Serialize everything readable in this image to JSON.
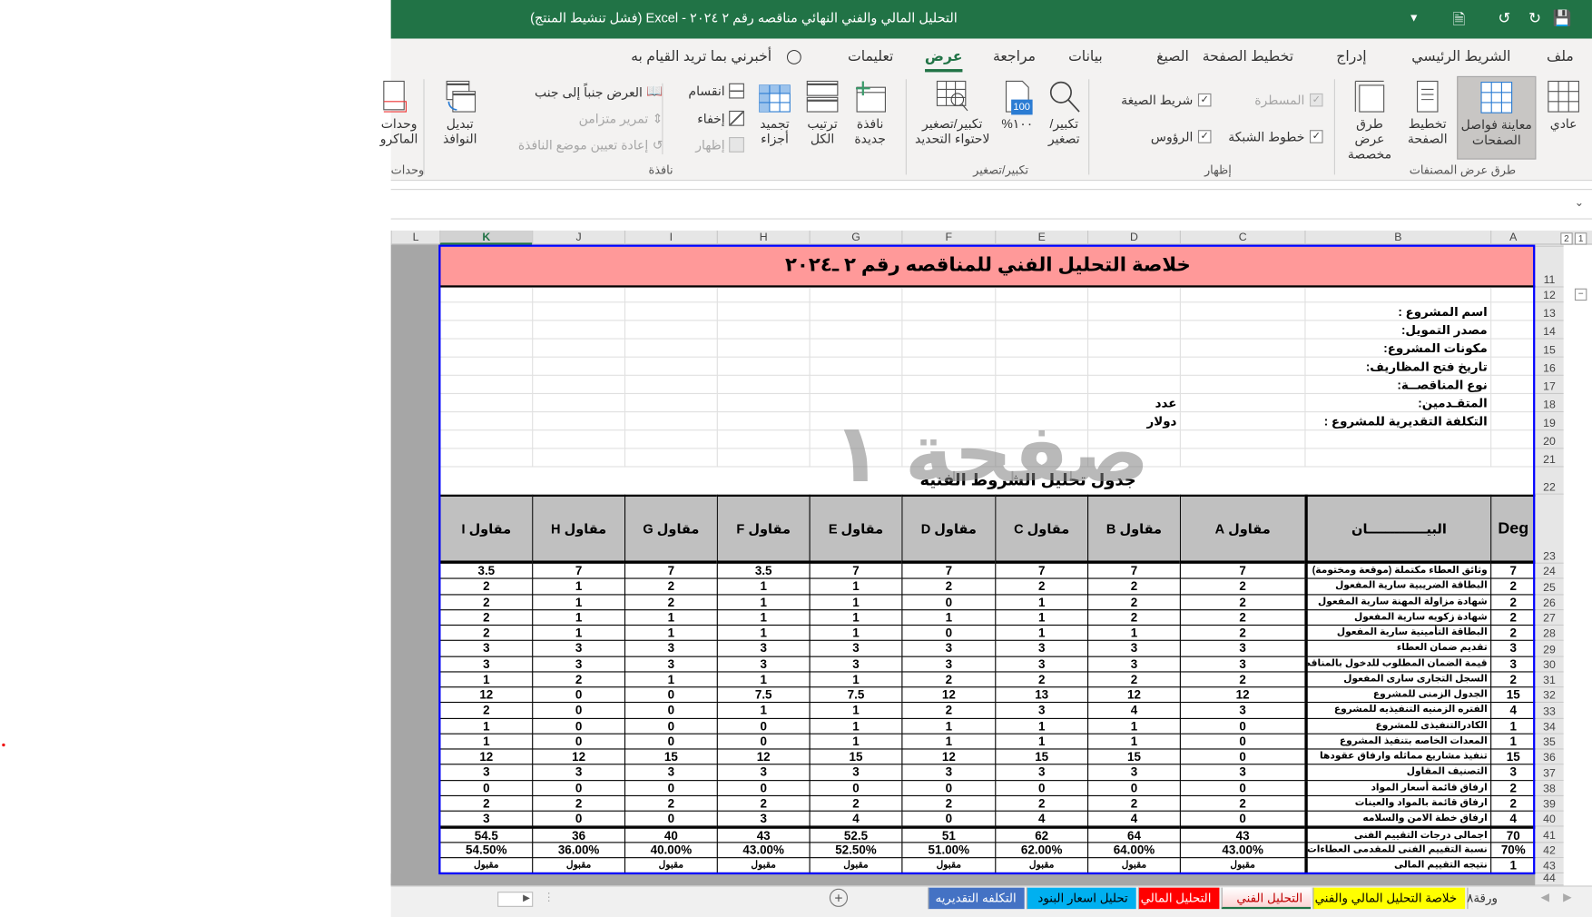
{
  "window": {
    "title": "التحليل المالي والفني النهائي مناقصه رقم ٢ ٢٠٢٤  -  Excel (فشل تنشيط المنتج)"
  },
  "menu": {
    "tabs": [
      "ملف",
      "الشريط الرئيسي",
      "إدراج",
      "تخطيط الصفحة",
      "الصيغ",
      "بيانات",
      "مراجعة",
      "عرض",
      "تعليمات"
    ],
    "active": "عرض",
    "tell_me": "أخبرني بما تريد القيام به"
  },
  "ribbon": {
    "views": {
      "group": "طرق عرض المصنفات",
      "normal": "عادي",
      "page_break": "معاينة فواصل الصفحات",
      "page_layout": "تخطيط الصفحة",
      "custom": "طرق عرض مخصصة"
    },
    "show": {
      "group": "إظهار",
      "ruler": "المسطرة",
      "formula_bar": "شريط الصيغة",
      "gridlines": "خطوط الشبكة",
      "headings": "الرؤوس"
    },
    "zoom": {
      "group": "تكبير/تصغير",
      "zoom": "تكبير/ تصغير",
      "zoom100": "١٠٠%",
      "icon100": "100",
      "zoom_sel": "تكبير/تصغير لاحتواء التحديد"
    },
    "window": {
      "group": "نافذة",
      "new": "نافذة جديدة",
      "arrange": "ترتيب الكل",
      "freeze": "تجميد أجزاء",
      "split": "انقسام",
      "hide": "إخفاء",
      "unhide": "إظهار",
      "side": "العرض جنباً إلى جنب",
      "sync": "تمرير متزامن",
      "reset": "إعادة تعيين موضع النافذة",
      "switch": "تبديل النوافذ"
    },
    "macros": {
      "group": "وحدات",
      "label": "وحدات الماكرو"
    }
  },
  "sheet": {
    "columns": [
      "A",
      "B",
      "C",
      "D",
      "E",
      "F",
      "G",
      "H",
      "I",
      "J",
      "K",
      "L"
    ],
    "selected_column": "K",
    "title": "خلاصة التحليل الفني للمناقصه رقم ٢ ـ٢٠٢٤",
    "info": [
      {
        "row": "13",
        "label": "اسم المشروع :",
        "value": ""
      },
      {
        "row": "14",
        "label": "مصدر التمويل:",
        "value": ""
      },
      {
        "row": "15",
        "label": "مكونات المشروع:",
        "value": ""
      },
      {
        "row": "16",
        "label": "تاريخ فتح المظاريف:",
        "value": ""
      },
      {
        "row": "17",
        "label": "نوع المناقصــة:",
        "value": ""
      },
      {
        "row": "18",
        "label": "المتقـدمين:",
        "value": "عدد"
      },
      {
        "row": "19",
        "label": "التكلفة التقديرية للمشروع :",
        "value": "دولار"
      }
    ],
    "table_title": "جدول تحليل الشروط الفنيه",
    "watermark": "صفحة ١",
    "headers": {
      "deg": "Deg",
      "item": "البيـــــــــــــان",
      "contractors": [
        "مقاول A",
        "مقاول B",
        "مقاول C",
        "مقاول D",
        "مقاول E",
        "مقاول F",
        "مقاول G",
        "مقاول H",
        "مقاول I"
      ]
    },
    "rows": [
      {
        "row": "24",
        "deg": "7",
        "item": "وثائق العطاء مكتملة (موقعة ومختومة)",
        "v": [
          "7",
          "7",
          "7",
          "7",
          "7",
          "3.5",
          "7",
          "7",
          "3.5"
        ]
      },
      {
        "row": "25",
        "deg": "2",
        "item": "البطاقة الضريبية سارية المفعول",
        "v": [
          "2",
          "2",
          "2",
          "2",
          "1",
          "1",
          "2",
          "1",
          "2"
        ]
      },
      {
        "row": "26",
        "deg": "2",
        "item": "شهادة مزاولة المهنة سارية المفعول",
        "v": [
          "2",
          "2",
          "1",
          "0",
          "1",
          "1",
          "2",
          "1",
          "2"
        ]
      },
      {
        "row": "27",
        "deg": "2",
        "item": "شهادة زكويه سارية المفعول",
        "v": [
          "2",
          "2",
          "1",
          "1",
          "1",
          "1",
          "1",
          "1",
          "2"
        ]
      },
      {
        "row": "28",
        "deg": "2",
        "item": "البطاقة التأمينية  سارية المفعول",
        "v": [
          "2",
          "1",
          "1",
          "0",
          "1",
          "1",
          "1",
          "1",
          "2"
        ]
      },
      {
        "row": "29",
        "deg": "3",
        "item": " تقديم ضمان العطاء",
        "v": [
          "3",
          "3",
          "3",
          "3",
          "3",
          "3",
          "3",
          "3",
          "3"
        ]
      },
      {
        "row": "30",
        "deg": "3",
        "item": "قيمة الضمان المطلوب للدخول بالمناقصه",
        "v": [
          "3",
          "3",
          "3",
          "3",
          "3",
          "3",
          "3",
          "3",
          "3"
        ]
      },
      {
        "row": "31",
        "deg": "2",
        "item": "السجل التجارى سارى المفعول",
        "v": [
          "2",
          "2",
          "2",
          "2",
          "1",
          "1",
          "1",
          "2",
          "1"
        ]
      },
      {
        "row": "32",
        "deg": "15",
        "item": "الجدول الزمنى للمشروع",
        "v": [
          "12",
          "12",
          "13",
          "12",
          "7.5",
          "7.5",
          "0",
          "0",
          "12"
        ]
      },
      {
        "row": "33",
        "deg": "4",
        "item": "الفتره الزمنيه التنفيذيه للمشروع",
        "v": [
          "3",
          "4",
          "3",
          "2",
          "1",
          "1",
          "0",
          "0",
          "2"
        ]
      },
      {
        "row": "34",
        "deg": "1",
        "item": "الكادرالتنفيذى للمشروع",
        "v": [
          "0",
          "1",
          "1",
          "1",
          "1",
          "0",
          "0",
          "0",
          "1"
        ]
      },
      {
        "row": "35",
        "deg": "1",
        "item": "المعدات الخاصه بتنفيذ المشروع",
        "v": [
          "0",
          "1",
          "1",
          "1",
          "1",
          "0",
          "0",
          "0",
          "1"
        ]
      },
      {
        "row": "36",
        "deg": "15",
        "item": "تنفيذ مشاريع مماثله وارفاق عقودها",
        "v": [
          "0",
          "15",
          "15",
          "12",
          "15",
          "12",
          "15",
          "12",
          "12"
        ]
      },
      {
        "row": "37",
        "deg": "3",
        "item": "التصنيف المقاول",
        "v": [
          "3",
          "3",
          "3",
          "3",
          "3",
          "3",
          "3",
          "3",
          "3"
        ]
      },
      {
        "row": "38",
        "deg": "2",
        "item": "ارفاق قائمة أسعار المواد",
        "v": [
          "0",
          "0",
          "0",
          "0",
          "0",
          "0",
          "0",
          "0",
          "0"
        ]
      },
      {
        "row": "39",
        "deg": "2",
        "item": "ارفاق قائمة بالمواد والعينات",
        "v": [
          "2",
          "2",
          "2",
          "2",
          "2",
          "2",
          "2",
          "2",
          "2"
        ]
      },
      {
        "row": "40",
        "deg": "4",
        "item": "ارفاق خطة الامن والسلامه",
        "v": [
          "0",
          "4",
          "4",
          "0",
          "4",
          "3",
          "0",
          "0",
          "3"
        ]
      },
      {
        "row": "41",
        "deg": "70",
        "item": "اجمالى درجات التقييم الفنى",
        "v": [
          "43",
          "64",
          "62",
          "51",
          "52.5",
          "43",
          "40",
          "36",
          "54.5"
        ]
      },
      {
        "row": "42",
        "deg": "70%",
        "item": "نسبة التقييم الفنى للمقدمى العطاءات",
        "v": [
          "43.00%",
          "64.00%",
          "62.00%",
          "51.00%",
          "52.50%",
          "43.00%",
          "40.00%",
          "36.00%",
          "54.50%"
        ]
      },
      {
        "row": "43",
        "deg": "1",
        "item": "نتيجه التقييم المالى",
        "v": [
          "مقبول",
          "مقبول",
          "مقبول",
          "مقبول",
          "مقبول",
          "مقبول",
          "مقبول",
          "مقبول",
          "مقبول"
        ]
      }
    ],
    "outline_levels": [
      "1",
      "2"
    ]
  },
  "sheet_tabs": [
    {
      "label": "ورقة٨",
      "color": "#f0f0f0",
      "text": "#333"
    },
    {
      "label": "خلاصة التحليل المالي والفني",
      "color": "#ffff00",
      "text": "#000"
    },
    {
      "label": "التحليل الفني",
      "color": "#fbd4d4",
      "text": "#c00000",
      "active": true
    },
    {
      "label": "التحليل المالي",
      "color": "#ff0000",
      "text": "#fff"
    },
    {
      "label": "تحليل اسعار البنود",
      "color": "#00b0f0",
      "text": "#000"
    },
    {
      "label": "التكلفه التقديريه",
      "color": "#4472c4",
      "text": "#fff"
    }
  ],
  "colors": {
    "accent": "#217346",
    "title_fill": "#ff9999",
    "header_fill": "#c0c0c0",
    "print_border": "#0000ff"
  }
}
